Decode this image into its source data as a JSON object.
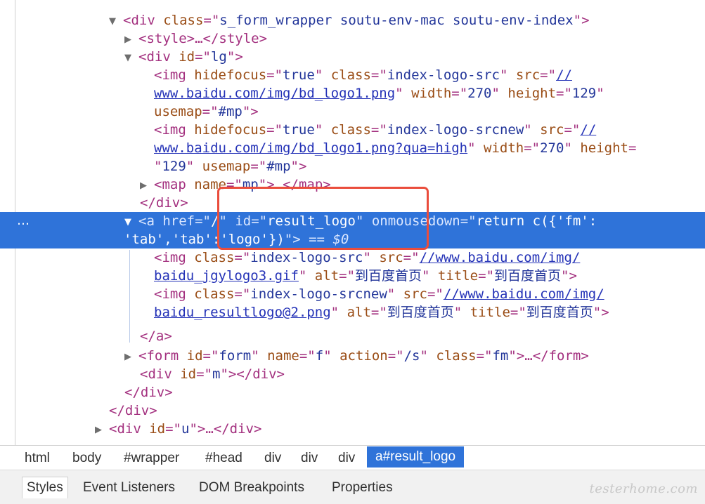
{
  "dom_tree": {
    "lines": [
      {
        "tokens": [
          "▼",
          "<div ",
          "class",
          "=\"",
          "s_form_wrapper soutu-env-mac soutu-env-index",
          "\">"
        ]
      },
      {
        "tokens": [
          "▶",
          "<style>…</style>"
        ]
      },
      {
        "tokens": [
          "▼",
          "<div ",
          "id",
          "=\"",
          "lg",
          "\">"
        ]
      },
      {
        "tokens": [
          "<img ",
          "hidefocus",
          "=\"",
          "true",
          "\" ",
          "class",
          "=\"",
          "index-logo-src",
          "\" ",
          "src",
          "=\"",
          "//"
        ]
      },
      {
        "tokens": [
          "www.baidu.com/img/bd_logo1.png",
          "\" ",
          "width",
          "=\"",
          "270",
          "\" ",
          "height",
          "=\"",
          "129",
          "\""
        ]
      },
      {
        "tokens": [
          "usemap",
          "=\"",
          "#mp",
          "\">"
        ]
      },
      {
        "tokens": [
          "<img ",
          "hidefocus",
          "=\"",
          "true",
          "\" ",
          "class",
          "=\"",
          "index-logo-srcnew",
          "\" ",
          "src",
          "=\"",
          "//"
        ]
      },
      {
        "tokens": [
          "www.baidu.com/img/bd_logo1.png?qua=high",
          "\" ",
          "width",
          "=\"",
          "270",
          "\" ",
          "height",
          "="
        ]
      },
      {
        "tokens": [
          "\"",
          "129",
          "\" ",
          "usemap",
          "=\"",
          "#mp",
          "\">"
        ]
      },
      {
        "tokens": [
          "▶",
          "<map ",
          "name",
          "=\"",
          "mp",
          "\">…</map>"
        ]
      },
      {
        "tokens": [
          "</div>"
        ]
      },
      {
        "tokens": [
          "▼",
          "<a ",
          "href",
          "=\"",
          "/",
          "\" ",
          "id",
          "=\"",
          "result_logo",
          "\" ",
          "onmousedown",
          "=\"",
          "return c({'fm':"
        ]
      },
      {
        "tokens": [
          "'tab','tab':'logo'})",
          "\">",
          " == ",
          "$0"
        ]
      },
      {
        "tokens": [
          "<img ",
          "class",
          "=\"",
          "index-logo-src",
          "\" ",
          "src",
          "=\"",
          "//www.baidu.com/img/"
        ]
      },
      {
        "tokens": [
          "baidu_jgylogo3.gif",
          "\" ",
          "alt",
          "=\"",
          "到百度首页",
          "\" ",
          "title",
          "=\"",
          "到百度首页",
          "\">"
        ]
      },
      {
        "tokens": [
          "<img ",
          "class",
          "=\"",
          "index-logo-srcnew",
          "\" ",
          "src",
          "=\"",
          "//www.baidu.com/img/"
        ]
      },
      {
        "tokens": [
          "baidu_resultlogo@2.png",
          "\" ",
          "alt",
          "=\"",
          "到百度首页",
          "\" ",
          "title",
          "=\"",
          "到百度首页",
          "\">"
        ]
      },
      {
        "tokens": [
          "</a>"
        ]
      },
      {
        "tokens": [
          "▶",
          "<form ",
          "id",
          "=\"",
          "form",
          "\" ",
          "name",
          "=\"",
          "f",
          "\" ",
          "action",
          "=\"",
          "/s",
          "\" ",
          "class",
          "=\"",
          "fm",
          "\">…</form>"
        ]
      },
      {
        "tokens": [
          "<div ",
          "id",
          "=\"",
          "m",
          "\"></div>"
        ]
      },
      {
        "tokens": [
          "</div>"
        ]
      },
      {
        "tokens": [
          "</div>"
        ]
      },
      {
        "tokens": [
          "▶",
          "<div ",
          "id",
          "=\"",
          "u",
          "\">…</div>"
        ]
      }
    ],
    "selected_marker": "…"
  },
  "breadcrumbs": [
    "html",
    "body",
    "#wrapper",
    "#head",
    "div",
    "div",
    "div",
    "a#result_logo"
  ],
  "tabs": [
    "Styles",
    "Event Listeners",
    "DOM Breakpoints",
    "Properties"
  ],
  "watermark": "testerhome.com"
}
